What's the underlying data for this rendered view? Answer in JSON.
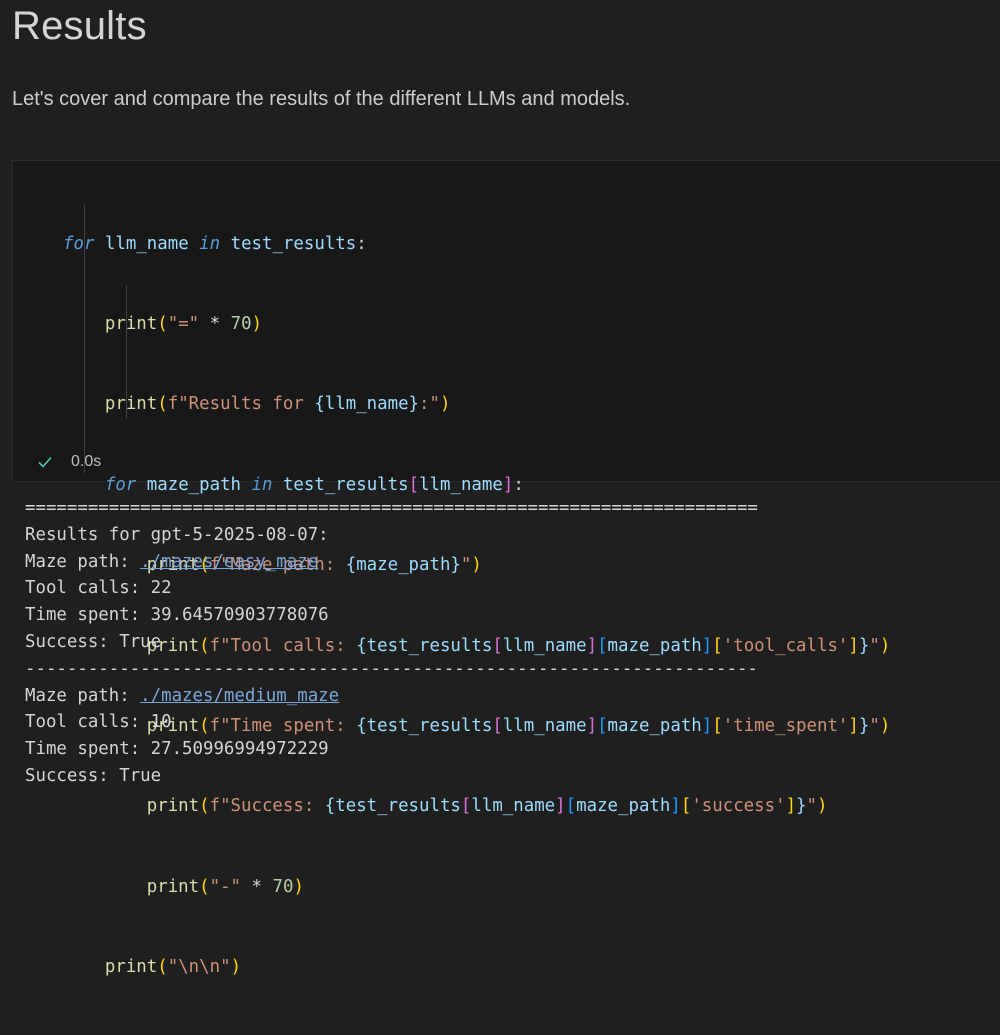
{
  "markdown": {
    "title": "Results",
    "text": "Let's cover and compare the results of the different LLMs and models."
  },
  "cell": {
    "status_time": "0.0s",
    "status_icon": "check-icon",
    "code_lines": [
      "for llm_name in test_results:",
      "    print(\"=\" * 70)",
      "    print(f\"Results for {llm_name}:\")",
      "    for maze_path in test_results[llm_name]:",
      "        print(f\"Maze path: {maze_path}\")",
      "        print(f\"Tool calls: {test_results[llm_name][maze_path]['tool_calls']}\")",
      "        print(f\"Time spent: {test_results[llm_name][maze_path]['time_spent']}\")",
      "        print(f\"Success: {test_results[llm_name][maze_path]['success']}\")",
      "        print(\"-\" * 70)",
      "    print(\"\\n\\n\")"
    ]
  },
  "output": {
    "separator_eq": "======================================================================",
    "results_for": "Results for gpt-5-2025-08-07:",
    "runs": [
      {
        "maze_prefix": "Maze path: ",
        "maze_link": "./mazes/easy_maze",
        "tool_calls": "Tool calls: 22",
        "time_spent": "Time spent: 39.64570903778076",
        "success": "Success: True"
      },
      {
        "maze_prefix": "Maze path: ",
        "maze_link": "./mazes/medium_maze",
        "tool_calls": "Tool calls: 10",
        "time_spent": "Time spent: 27.50996994972229",
        "success": "Success: True"
      }
    ],
    "separator_dash": "----------------------------------------------------------------------"
  },
  "colors": {
    "background": "#1f1f1f",
    "cell_background": "#181818",
    "keyword": "#569cd6",
    "function": "#dcdcaa",
    "string": "#ce9178",
    "link": "#7aa6da",
    "success_check": "#4ec9b0"
  }
}
